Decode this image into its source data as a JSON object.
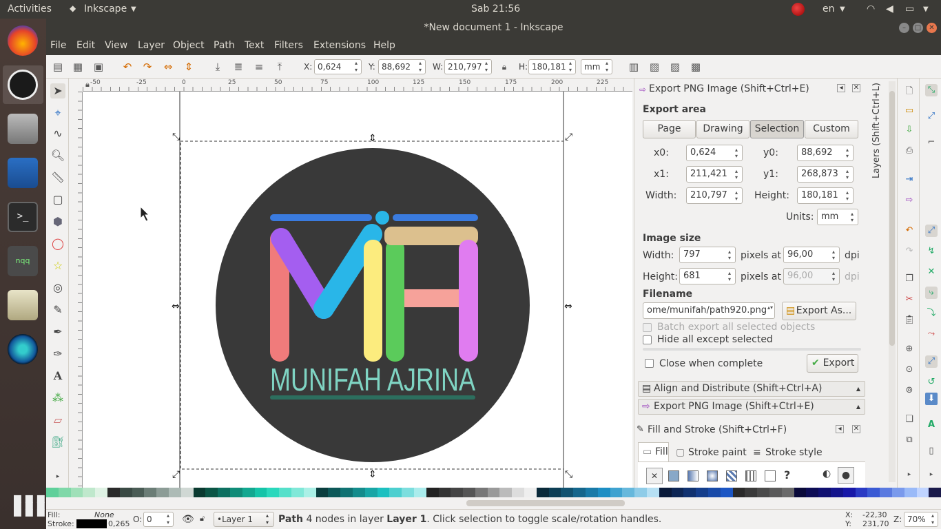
{
  "system": {
    "activities": "Activities",
    "app_menu": "Inkscape",
    "clock": "Sab 21:56",
    "lang": "en"
  },
  "window": {
    "title": "*New document 1 - Inkscape"
  },
  "menu": [
    "File",
    "Edit",
    "View",
    "Layer",
    "Object",
    "Path",
    "Text",
    "Filters",
    "Extensions",
    "Help"
  ],
  "toolbar": {
    "x_label": "X:",
    "x": "0,624",
    "y_label": "Y:",
    "y": "88,692",
    "w_label": "W:",
    "w": "210,797",
    "h_label": "H:",
    "h": "180,181",
    "unit": "mm"
  },
  "ruler": {
    "ticks": [
      "-50",
      "-25",
      "0",
      "25",
      "50",
      "75",
      "100",
      "125",
      "150",
      "175",
      "200",
      "225"
    ]
  },
  "logo": {
    "name_text": "MUNIFAH AJRINA",
    "colors": {
      "circle": "#393939",
      "blue": "#3a7bdf",
      "cyan": "#29b6e8",
      "purple": "#a45ef0",
      "red": "#f07b7b",
      "yellow": "#fcec7e",
      "green": "#5bcb5b",
      "tan": "#dcc08e",
      "pink": "#f6a29a",
      "violet": "#e07cf0",
      "mint": "#7fd4c3",
      "teal": "#2c6e5e"
    }
  },
  "export": {
    "title": "Export PNG Image (Shift+Ctrl+E)",
    "area_heading": "Export area",
    "area_buttons": [
      "Page",
      "Drawing",
      "Selection",
      "Custom"
    ],
    "active_area": "Selection",
    "x0_label": "x0:",
    "x0": "0,624",
    "y0_label": "y0:",
    "y0": "88,692",
    "x1_label": "x1:",
    "x1": "211,421",
    "y1_label": "y1:",
    "y1": "268,873",
    "width_label": "Width:",
    "width": "210,797",
    "height_label": "Height:",
    "height": "180,181",
    "units_label": "Units:",
    "units": "mm",
    "size_heading": "Image size",
    "img_width_label": "Width:",
    "img_width": "797",
    "pixels_at": "pixels at",
    "dpi_x": "96,00",
    "dpi": "dpi",
    "img_height_label": "Height:",
    "img_height": "681",
    "pixels_at2": "pixels at",
    "dpi_y": "96,00",
    "dpi2": "dpi",
    "filename_heading": "Filename",
    "filename": "ome/munifah/path920.png",
    "export_as": "Export As...",
    "batch": "Batch export all selected objects",
    "hide": "Hide all except selected",
    "close_when": "Close when complete",
    "export_btn": "Export"
  },
  "docked": {
    "align": "Align and Distribute (Shift+Ctrl+A)",
    "export2": "Export PNG Image (Shift+Ctrl+E)",
    "layers_tab": "Layers (Shift+Ctrl+L)"
  },
  "fillstroke": {
    "title": "Fill and Stroke (Shift+Ctrl+F)",
    "tabs": [
      "Fill",
      "Stroke paint",
      "Stroke style"
    ]
  },
  "status": {
    "fill_label": "Fill:",
    "fill_value": "None",
    "stroke_label": "Stroke:",
    "stroke_width": "0,265",
    "opacity_label": "O:",
    "opacity": "0",
    "layer": "•Layer 1",
    "msg_a": "Path",
    "msg_b": " 4 nodes in layer ",
    "msg_c": "Layer 1",
    "msg_d": ". Click selection to toggle scale/rotation handles.",
    "cx_label": "X:",
    "cx": "-22,30",
    "cy_label": "Y:",
    "cy": "231,70",
    "zoom_label": "Z:",
    "zoom": "70%"
  },
  "palette": [
    "#5fd09a",
    "#7fd8a8",
    "#9fe0b8",
    "#bfe8cc",
    "#dff2e4",
    "#2a2a2a",
    "#3a4a44",
    "#4a5c55",
    "#6b7d76",
    "#8c9c96",
    "#adbbb6",
    "#d0d8d4",
    "#0a3a30",
    "#0b5545",
    "#0d7060",
    "#0f8c78",
    "#12a890",
    "#15c4a8",
    "#2ad8bc",
    "#55e0ca",
    "#80e8d8",
    "#aaf0e6",
    "#0a3e3e",
    "#0d5858",
    "#107272",
    "#148c8c",
    "#18a6a6",
    "#1cc0c0",
    "#4ccfcf",
    "#7cdede",
    "#aaecec",
    "#222",
    "#333",
    "#444",
    "#555",
    "#777",
    "#999",
    "#bbb",
    "#ddd",
    "#eee",
    "#0a2a3a",
    "#0d3e55",
    "#105270",
    "#14668c",
    "#187aa8",
    "#1c8ec4",
    "#3ea2d0",
    "#66b8dc",
    "#8ecce8",
    "#b6e0f4",
    "#0a1a3a",
    "#0d2655",
    "#103270",
    "#143e8c",
    "#184aa8",
    "#1c56c4",
    "#2a2a2a",
    "#3a3a3a",
    "#4a4a4a",
    "#5a5a5a",
    "#6a6a6a",
    "#0a0a3a",
    "#0d0d55",
    "#101070",
    "#14148c",
    "#1818a8",
    "#2a3ac4",
    "#3a5ad4",
    "#5a7ae0",
    "#7a9aec",
    "#9abaf8",
    "#c0d4ff",
    "#1a1a4a"
  ]
}
